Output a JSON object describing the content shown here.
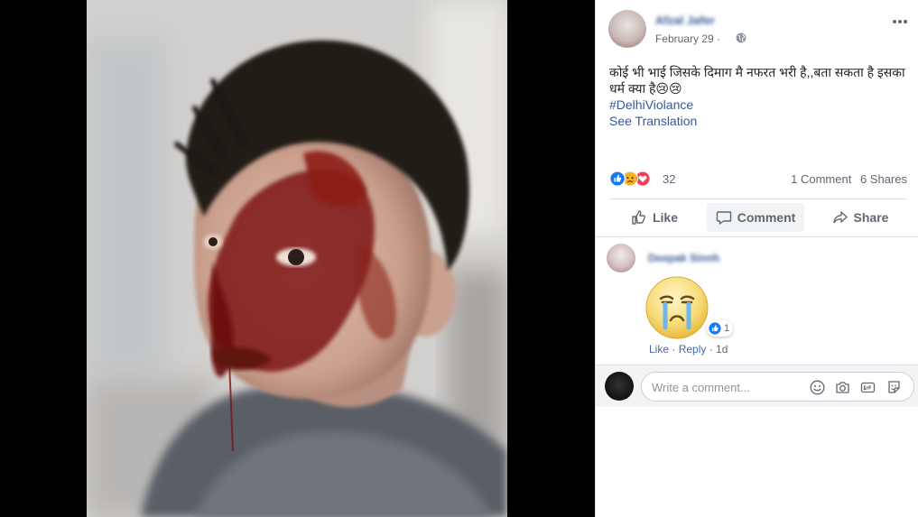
{
  "post": {
    "author": "Afzal Jafer",
    "date": "February 29 ·",
    "text": "कोई भी भाई जिसके दिमाग मै नफरत भरी है,,बता सकता है इसका धर्म क्या है😢😢",
    "hashtag": "#DelhiViolance",
    "see_translation": "See Translation"
  },
  "reactions": {
    "count": "32",
    "comments": "1 Comment",
    "shares": "6 Shares"
  },
  "actions": {
    "like": "Like",
    "comment": "Comment",
    "share": "Share"
  },
  "comment": {
    "author": "Deepak Sinnh",
    "reaction_count": "1",
    "like": "Like",
    "sep1": " · ",
    "reply": "Reply",
    "sep2": " · ",
    "time": "1d"
  },
  "write_comment": {
    "placeholder": "Write a comment..."
  },
  "colors": {
    "link": "#365899",
    "like_blue": "#1877f2",
    "love_red": "#f33e58",
    "sad_yellow": "#f7b125"
  },
  "icons": [
    "globe-icon",
    "more-options-icon",
    "like-reaction-icon",
    "sad-reaction-icon",
    "love-reaction-icon",
    "thumbs-up-icon",
    "comment-icon",
    "share-icon",
    "crying-sticker",
    "emoji-icon",
    "camera-icon",
    "gif-icon",
    "sticker-icon"
  ]
}
